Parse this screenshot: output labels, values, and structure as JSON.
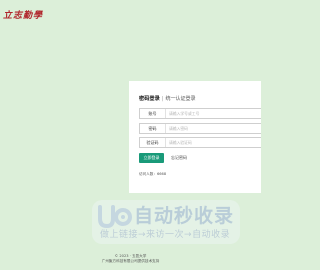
{
  "logo": {
    "text": "立志勤學"
  },
  "login": {
    "tab_active": "密码登录",
    "tab_separator": "|",
    "tab_inactive": "统一认证登录",
    "account_label": "账号",
    "account_placeholder": "请输入学号或工号",
    "password_label": "密码",
    "password_placeholder": "请输入密码",
    "captcha_label": "验证码",
    "captcha_placeholder": "请输入验证码",
    "login_button": "立即登录",
    "forgot_link": "忘记密码",
    "visits": "访问人数：6668"
  },
  "watermark": {
    "title": "自动秒收录",
    "slogan": "做上链接→来访一次→自动收录"
  },
  "footer": {
    "copyright": "© 2023 · 五邑大学",
    "support": "广州聚方科技有限公司提供技术支持"
  },
  "colors": {
    "background": "#dcefd9",
    "logo_red": "#b0242b",
    "button_green": "#199a79"
  }
}
